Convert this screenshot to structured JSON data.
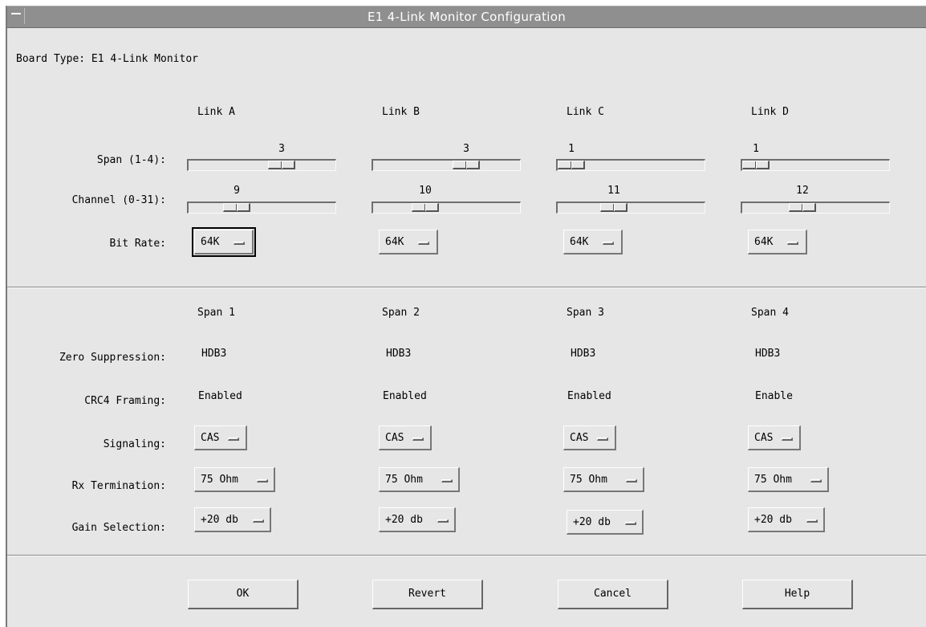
{
  "window": {
    "title": "E1 4-Link Monitor Configuration"
  },
  "board_type": "Board Type: E1 4-Link Monitor",
  "links": {
    "headers": [
      "Link A",
      "Link B",
      "Link C",
      "Link D"
    ],
    "span_label": "Span (1-4):",
    "channel_label": "Channel (0-31):",
    "bitrate_label": "Bit Rate:",
    "span": {
      "values": [
        "3",
        "3",
        "1",
        "1"
      ],
      "numeric": [
        3,
        3,
        1,
        1
      ],
      "min": 1,
      "max": 4
    },
    "channel": {
      "values": [
        "9",
        "10",
        "11",
        "12"
      ],
      "numeric": [
        9,
        10,
        11,
        12
      ],
      "min": 0,
      "max": 31
    },
    "bitrate": [
      "64K",
      "64K",
      "64K",
      "64K"
    ]
  },
  "spans": {
    "headers": [
      "Span 1",
      "Span 2",
      "Span 3",
      "Span 4"
    ],
    "zero_suppression_label": "Zero Suppression:",
    "zero_suppression": [
      "HDB3",
      "HDB3",
      "HDB3",
      "HDB3"
    ],
    "crc4_label": "CRC4 Framing:",
    "crc4": [
      "Enabled",
      "Enabled",
      "Enabled",
      "Enable"
    ],
    "signaling_label": "Signaling:",
    "signaling": [
      "CAS",
      "CAS",
      "CAS",
      "CAS"
    ],
    "rx_label": "Rx Termination:",
    "rx": [
      "75 Ohm",
      "75 Ohm",
      "75 Ohm",
      "75 Ohm"
    ],
    "gain_label": "Gain Selection:",
    "gain": [
      "+20 db",
      "+20 db",
      "+20 db",
      "+20 db"
    ]
  },
  "buttons": {
    "ok": "OK",
    "revert": "Revert",
    "cancel": "Cancel",
    "help": "Help"
  }
}
